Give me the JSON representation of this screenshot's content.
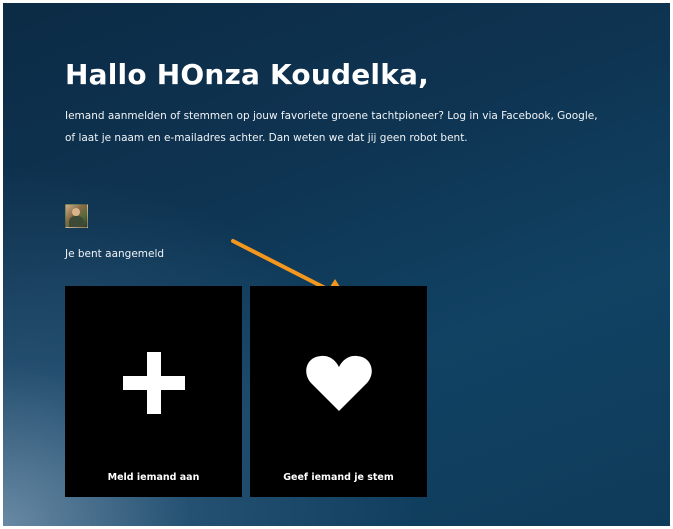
{
  "greeting": {
    "title": "Hallo HOnza Koudelka,"
  },
  "intro": {
    "text": "Iemand aanmelden of stemmen op jouw favoriete groene tachtpioneer? Log in via Facebook, Google, of laat je naam en e-mailadres achter. Dan weten we dat jij geen robot bent."
  },
  "user": {
    "status": "Je bent aangemeld"
  },
  "actions": [
    {
      "label": "Meld iemand aan",
      "icon": "plus-icon"
    },
    {
      "label": "Geef iemand je stem",
      "icon": "heart-icon"
    }
  ],
  "colors": {
    "background_dark": "#0c2b45",
    "background_light": "#7896af",
    "card": "#000000",
    "text": "#ffffff",
    "annotation_arrow": "#f5961d"
  }
}
